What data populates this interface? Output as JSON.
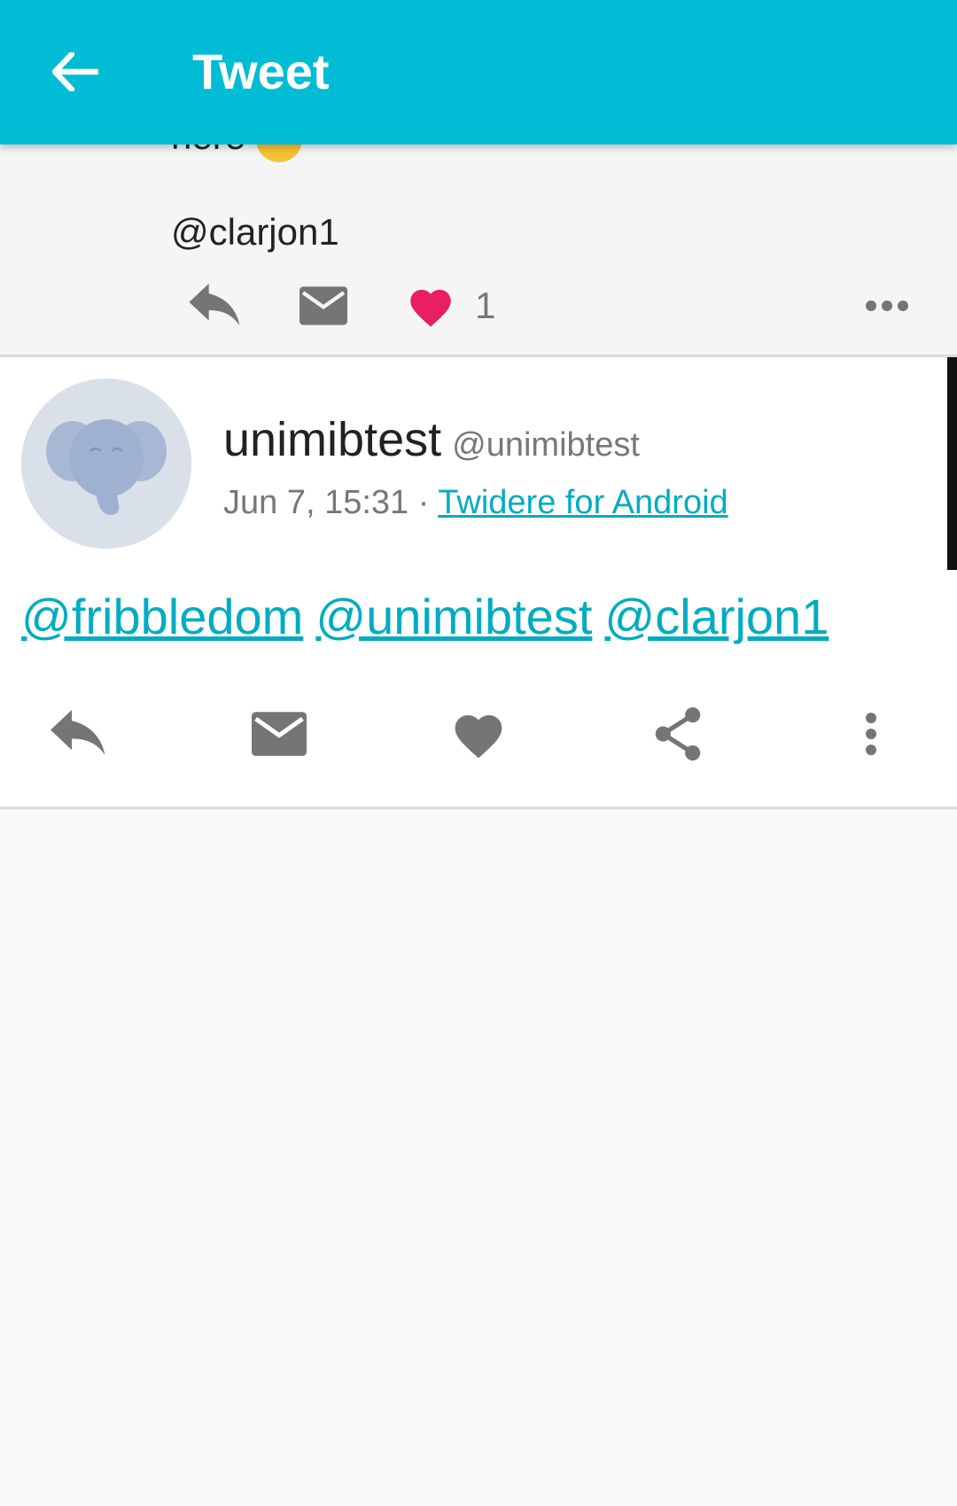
{
  "appbar": {
    "title": "Tweet",
    "back_icon": "arrow-back-icon",
    "background": "#00bcd4"
  },
  "prev_tweet": {
    "text_line": "here",
    "mention": "@clarjon1",
    "actions": {
      "reply_icon": "reply-icon",
      "message_icon": "mail-icon",
      "like_icon": "heart-icon",
      "like_count": "1",
      "like_color": "#e91e63",
      "more_icon": "more-horizontal-icon"
    }
  },
  "main_tweet": {
    "avatar_icon": "elephant-avatar-icon",
    "user_name": "unimibtest",
    "user_handle": "@unimibtest",
    "timestamp": "Jun 7, 15:31",
    "separator": "·",
    "source": "Twidere for Android",
    "mentions": [
      "@fribbledom",
      "@unimibtest",
      "@clarjon1"
    ],
    "link_color": "#00acc1",
    "actions": {
      "reply_icon": "reply-icon",
      "message_icon": "mail-icon",
      "like_icon": "heart-icon",
      "share_icon": "share-icon",
      "more_icon": "more-vertical-icon"
    }
  }
}
